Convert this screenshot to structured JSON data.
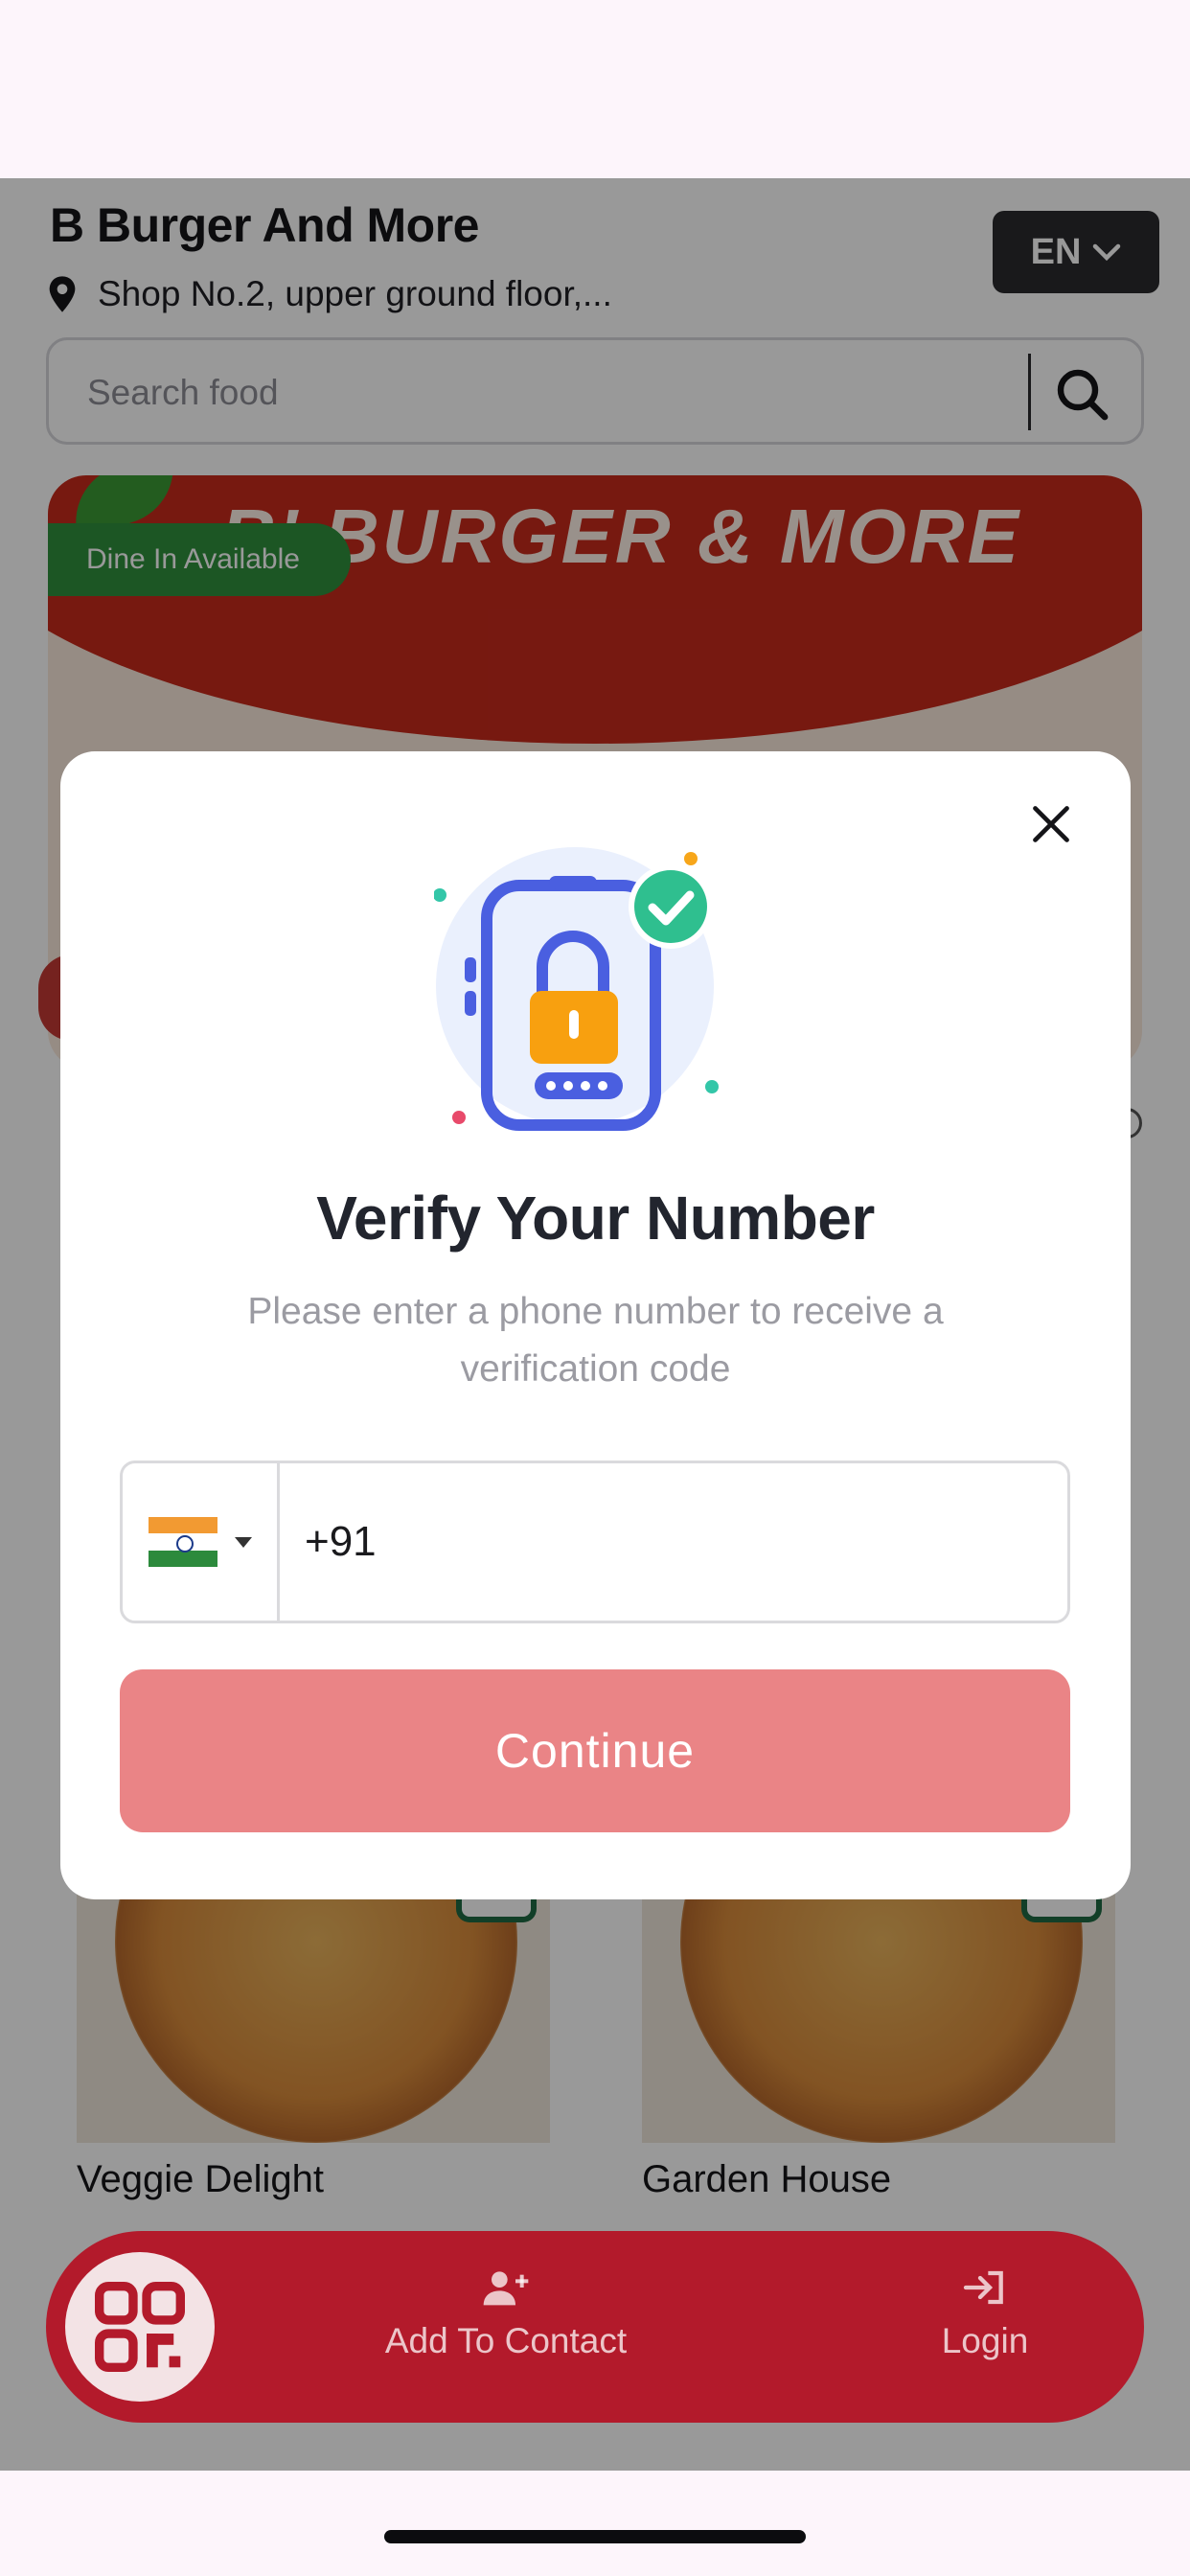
{
  "header": {
    "restaurant_name": "B Burger And More",
    "address": "Shop No.2, upper ground floor,...",
    "language": "EN"
  },
  "search": {
    "placeholder": "Search food"
  },
  "banner": {
    "title": "B' BURGER & MORE",
    "badge": "Dine In Available"
  },
  "menu_items": [
    {
      "name": "Veggie Delight"
    },
    {
      "name": "Garden House"
    }
  ],
  "bottom_nav": {
    "contact_label": "Add To Contact",
    "login_label": "Login"
  },
  "modal": {
    "title": "Verify Your Number",
    "subtitle": "Please enter a phone number to receive a verification code",
    "country_code": "+91",
    "continue_label": "Continue"
  },
  "colors": {
    "brand_red": "#b31a2b",
    "continue_button": "#ea8486",
    "veg_green": "#1f6a43"
  },
  "icons": [
    "location-pin-icon",
    "chevron-down-icon",
    "search-icon",
    "qr-code-icon",
    "add-user-icon",
    "login-icon",
    "close-icon",
    "phone-lock-icon",
    "india-flag-icon"
  ]
}
